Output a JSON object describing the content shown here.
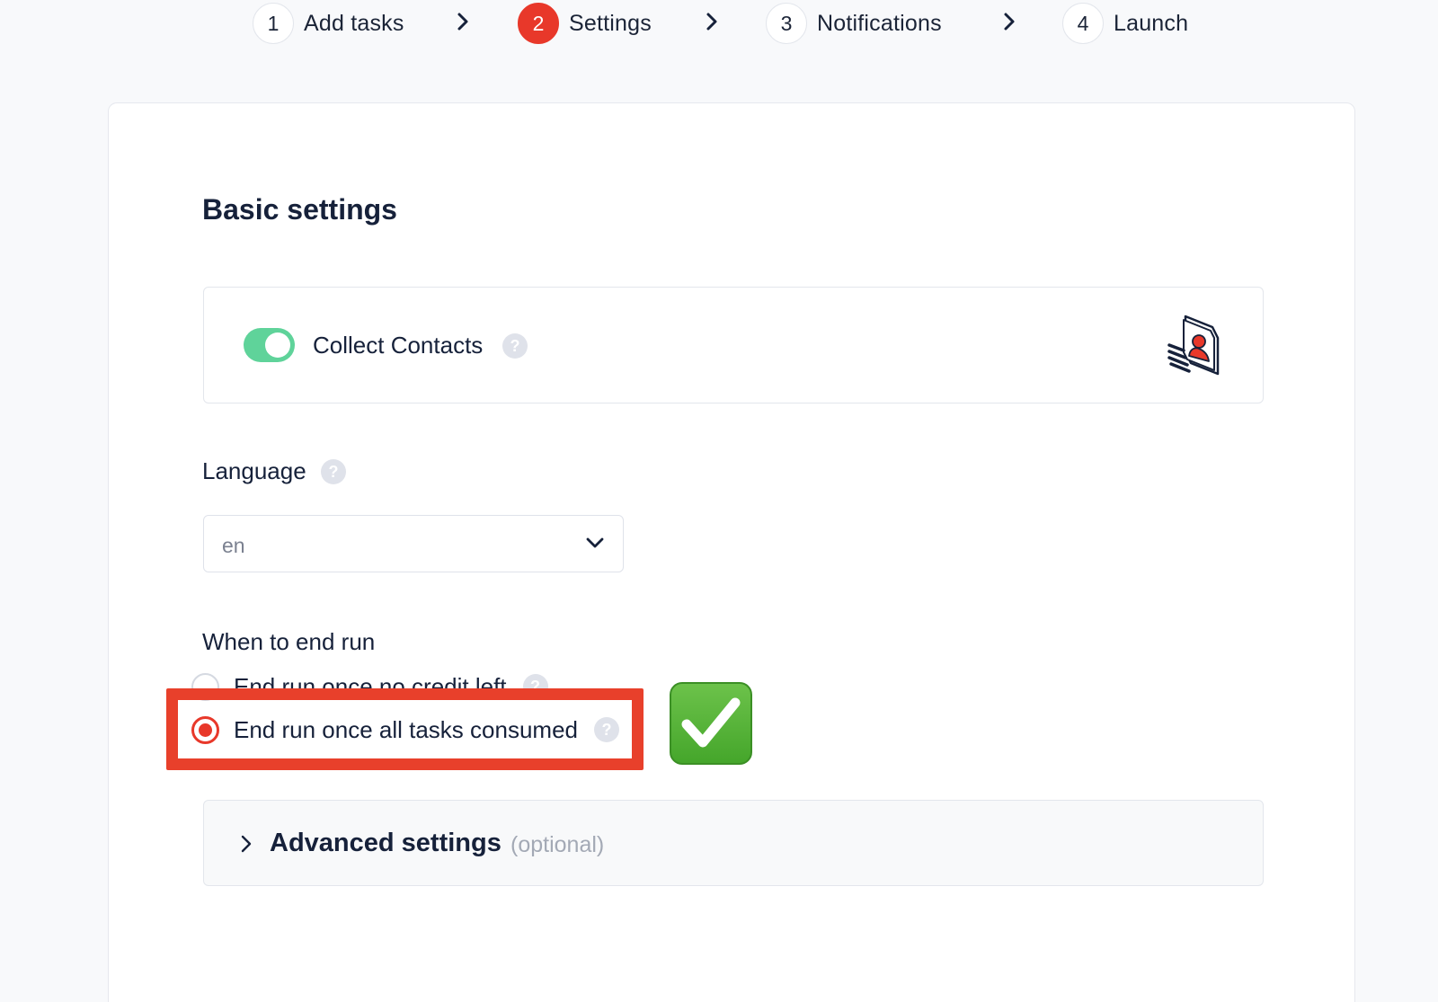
{
  "stepper": {
    "steps": [
      {
        "number": "1",
        "label": "Add tasks",
        "active": false
      },
      {
        "number": "2",
        "label": "Settings",
        "active": true
      },
      {
        "number": "3",
        "label": "Notifications",
        "active": false
      },
      {
        "number": "4",
        "label": "Launch",
        "active": false
      }
    ],
    "separator_icon": "chevron-right-icon"
  },
  "basic_settings": {
    "title": "Basic settings",
    "collect_contacts": {
      "label": "Collect Contacts",
      "enabled": true,
      "help": "?",
      "illustration_icon": "contact-card-icon"
    },
    "language": {
      "label": "Language",
      "help": "?",
      "selected": "en"
    },
    "end_run": {
      "label": "When to end run",
      "options": [
        {
          "label": "End run once no credit left",
          "checked": false,
          "help": "?"
        },
        {
          "label": "End run once all tasks consumed",
          "checked": true,
          "help": "?"
        }
      ],
      "annotation_icon": "check-mark-button-icon"
    }
  },
  "advanced_settings": {
    "title": "Advanced settings",
    "optional_label": "(optional)"
  },
  "colors": {
    "accent": "#e8382a",
    "toggle_on": "#5fd39a",
    "highlight_box": "#e8402b",
    "check_emoji": "#45a62b"
  }
}
